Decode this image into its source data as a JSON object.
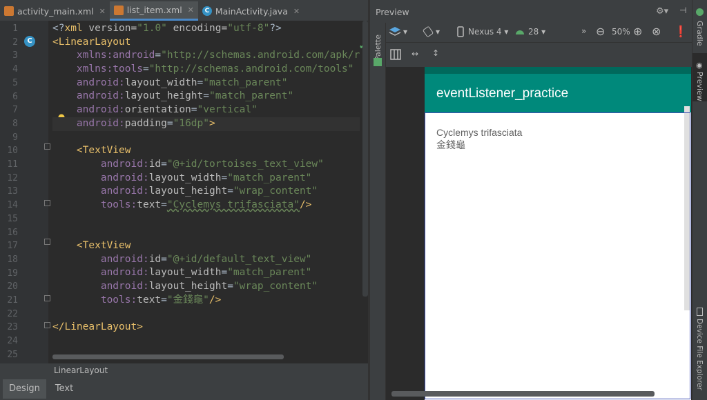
{
  "tabs": [
    {
      "label": "activity_main.xml",
      "icon": "xml-file-icon"
    },
    {
      "label": "list_item.xml",
      "icon": "xml-file-icon"
    },
    {
      "label": "MainActivity.java",
      "icon": "class-icon"
    }
  ],
  "editor": {
    "line_numbers": [
      "1",
      "2",
      "3",
      "4",
      "5",
      "6",
      "7",
      "8",
      "9",
      "10",
      "11",
      "12",
      "13",
      "14",
      "15",
      "16",
      "17",
      "18",
      "19",
      "20",
      "21",
      "22",
      "23",
      "24",
      "25"
    ],
    "lines": [
      [
        [
          "plain",
          "<?"
        ],
        [
          "tag",
          "xml"
        ],
        [
          "attr",
          " version="
        ],
        [
          "val",
          "\"1.0\""
        ],
        [
          "attr",
          " encoding="
        ],
        [
          "val",
          "\"utf-8\""
        ],
        [
          "plain",
          "?>"
        ]
      ],
      [
        [
          "tag",
          "<LinearLayout"
        ]
      ],
      [
        [
          "plain",
          "    "
        ],
        [
          "ns",
          "xmlns:android"
        ],
        [
          "plain",
          "="
        ],
        [
          "val",
          "\"http://schemas.android.com/apk/r"
        ]
      ],
      [
        [
          "plain",
          "    "
        ],
        [
          "ns",
          "xmlns:tools"
        ],
        [
          "plain",
          "="
        ],
        [
          "val",
          "\"http://schemas.android.com/tools\""
        ]
      ],
      [
        [
          "plain",
          "    "
        ],
        [
          "ns",
          "android:"
        ],
        [
          "attr",
          "layout_width"
        ],
        [
          "plain",
          "="
        ],
        [
          "val",
          "\"match_parent\""
        ]
      ],
      [
        [
          "plain",
          "    "
        ],
        [
          "ns",
          "android:"
        ],
        [
          "attr",
          "layout_height"
        ],
        [
          "plain",
          "="
        ],
        [
          "val",
          "\"match_parent\""
        ]
      ],
      [
        [
          "plain",
          "    "
        ],
        [
          "ns",
          "android:"
        ],
        [
          "attr",
          "orientation"
        ],
        [
          "plain",
          "="
        ],
        [
          "val",
          "\"vertical\""
        ]
      ],
      [
        [
          "plain",
          "    "
        ],
        [
          "ns",
          "android:"
        ],
        [
          "attr",
          "padding"
        ],
        [
          "plain",
          "="
        ],
        [
          "val",
          "\"16dp\""
        ],
        [
          "tag",
          ">"
        ]
      ],
      [],
      [
        [
          "plain",
          "    "
        ],
        [
          "tag",
          "<TextView"
        ]
      ],
      [
        [
          "plain",
          "        "
        ],
        [
          "ns",
          "android:"
        ],
        [
          "attr",
          "id"
        ],
        [
          "plain",
          "="
        ],
        [
          "val",
          "\"@+id/tortoises_text_view\""
        ]
      ],
      [
        [
          "plain",
          "        "
        ],
        [
          "ns",
          "android:"
        ],
        [
          "attr",
          "layout_width"
        ],
        [
          "plain",
          "="
        ],
        [
          "val",
          "\"match_parent\""
        ]
      ],
      [
        [
          "plain",
          "        "
        ],
        [
          "ns",
          "android:"
        ],
        [
          "attr",
          "layout_height"
        ],
        [
          "plain",
          "="
        ],
        [
          "val",
          "\"wrap_content\""
        ]
      ],
      [
        [
          "plain",
          "        "
        ],
        [
          "ns",
          "tools:"
        ],
        [
          "attr",
          "text"
        ],
        [
          "plain",
          "="
        ],
        [
          "val",
          "\"Cyclemys trifasciata\""
        ],
        [
          "tag",
          "/>"
        ]
      ],
      [],
      [],
      [
        [
          "plain",
          "    "
        ],
        [
          "tag",
          "<TextView"
        ]
      ],
      [
        [
          "plain",
          "        "
        ],
        [
          "ns",
          "android:"
        ],
        [
          "attr",
          "id"
        ],
        [
          "plain",
          "="
        ],
        [
          "val",
          "\"@+id/default_text_view\""
        ]
      ],
      [
        [
          "plain",
          "        "
        ],
        [
          "ns",
          "android:"
        ],
        [
          "attr",
          "layout_width"
        ],
        [
          "plain",
          "="
        ],
        [
          "val",
          "\"match_parent\""
        ]
      ],
      [
        [
          "plain",
          "        "
        ],
        [
          "ns",
          "android:"
        ],
        [
          "attr",
          "layout_height"
        ],
        [
          "plain",
          "="
        ],
        [
          "val",
          "\"wrap_content\""
        ]
      ],
      [
        [
          "plain",
          "        "
        ],
        [
          "ns",
          "tools:"
        ],
        [
          "attr",
          "text"
        ],
        [
          "plain",
          "="
        ],
        [
          "val",
          "\"金錢龜\""
        ],
        [
          "tag",
          "/>"
        ]
      ],
      [],
      [
        [
          "tag",
          "</LinearLayout>"
        ]
      ],
      [],
      []
    ]
  },
  "breadcrumb": "LinearLayout",
  "bottom_tabs": {
    "design": "Design",
    "text": "Text"
  },
  "preview": {
    "title": "Preview",
    "device": "Nexus 4",
    "api": "28",
    "zoom": "50%",
    "app_title": "eventListener_practice",
    "text1": "Cyclemys trifasciata",
    "text2": "金錢龜",
    "app_bar_color": "#00897b"
  },
  "side_labels": {
    "palette": "Palette",
    "gradle": "Gradle",
    "preview": "Preview",
    "device_file_explorer": "Device File Explorer"
  }
}
